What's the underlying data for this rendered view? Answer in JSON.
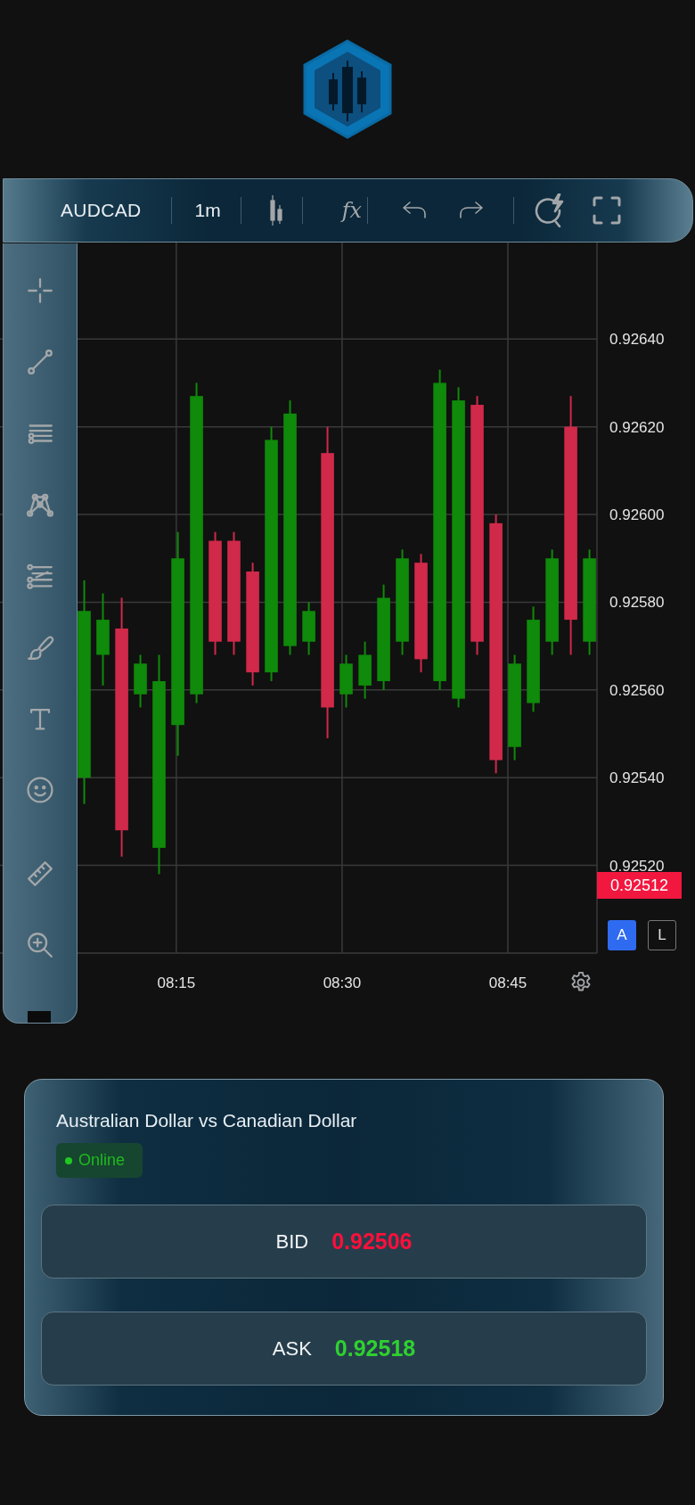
{
  "toolbar": {
    "symbol": "AUDCAD",
    "interval": "1m",
    "indicators": "fx"
  },
  "chart": {
    "chart_data": {
      "type": "candlestick",
      "grid": true,
      "xlim": [
        479.05,
        533.06
      ],
      "ylim": [
        0.925,
        0.92662
      ],
      "x": [
        486.67,
        488.36,
        490.06,
        491.75,
        493.44,
        495.14,
        496.83,
        498.52,
        500.21,
        501.91,
        503.6,
        505.29,
        506.99,
        508.68,
        510.37,
        512.07,
        513.76,
        515.45,
        517.14,
        518.84,
        520.53,
        522.22,
        523.92,
        525.61,
        527.3,
        529.0,
        530.69,
        532.38
      ],
      "ohlc": [
        [
          0.9254,
          0.92585,
          0.92534,
          0.92578
        ],
        [
          0.92568,
          0.92582,
          0.92561,
          0.92576
        ],
        [
          0.92574,
          0.92581,
          0.92522,
          0.92528
        ],
        [
          0.92559,
          0.92568,
          0.92556,
          0.92566
        ],
        [
          0.92524,
          0.92568,
          0.92518,
          0.92562
        ],
        [
          0.92552,
          0.92596,
          0.92545,
          0.9259
        ],
        [
          0.92559,
          0.9263,
          0.92557,
          0.92627
        ],
        [
          0.92594,
          0.92596,
          0.92568,
          0.92571
        ],
        [
          0.92594,
          0.92596,
          0.92568,
          0.92571
        ],
        [
          0.92587,
          0.92589,
          0.92561,
          0.92564
        ],
        [
          0.92564,
          0.9262,
          0.92562,
          0.92617
        ],
        [
          0.9257,
          0.92626,
          0.92568,
          0.92623
        ],
        [
          0.92571,
          0.9258,
          0.92568,
          0.92578
        ],
        [
          0.92614,
          0.9262,
          0.92549,
          0.92556
        ],
        [
          0.92559,
          0.92568,
          0.92556,
          0.92566
        ],
        [
          0.92561,
          0.92571,
          0.92558,
          0.92568
        ],
        [
          0.92562,
          0.92584,
          0.9256,
          0.92581
        ],
        [
          0.92571,
          0.92592,
          0.92568,
          0.9259
        ],
        [
          0.92589,
          0.92591,
          0.92564,
          0.92567
        ],
        [
          0.92562,
          0.92633,
          0.9256,
          0.9263
        ],
        [
          0.92558,
          0.92629,
          0.92556,
          0.92626
        ],
        [
          0.92625,
          0.92627,
          0.92568,
          0.92571
        ],
        [
          0.92598,
          0.926,
          0.92541,
          0.92544
        ],
        [
          0.92547,
          0.92568,
          0.92544,
          0.92566
        ],
        [
          0.92557,
          0.92579,
          0.92555,
          0.92576
        ],
        [
          0.92571,
          0.92592,
          0.92568,
          0.9259
        ],
        [
          0.9262,
          0.92627,
          0.92568,
          0.92576
        ],
        [
          0.92571,
          0.92592,
          0.92568,
          0.9259
        ]
      ],
      "yticks": [
        {
          "value": 0.9264,
          "label": "0.92640"
        },
        {
          "value": 0.9262,
          "label": "0.92620"
        },
        {
          "value": 0.926,
          "label": "0.92600"
        },
        {
          "value": 0.9258,
          "label": "0.92580"
        },
        {
          "value": 0.9256,
          "label": "0.92560"
        },
        {
          "value": 0.9254,
          "label": "0.92540"
        },
        {
          "value": 0.9252,
          "label": "0.92520"
        }
      ],
      "xticks": [
        {
          "value": 495,
          "label": "08:15"
        },
        {
          "value": 510,
          "label": "08:30"
        },
        {
          "value": 525,
          "label": "08:45"
        }
      ]
    },
    "last_price": "0.92512",
    "scale_buttons": [
      {
        "label": "A",
        "selected": true
      },
      {
        "label": "L",
        "selected": false
      }
    ]
  },
  "quote": {
    "title": "Australian Dollar vs Canadian Dollar",
    "status": {
      "label": "Online",
      "online": true
    },
    "prices": [
      {
        "label": "BID",
        "value": "0.92506",
        "kind": "bid"
      },
      {
        "label": "ASK",
        "value": "0.92518",
        "kind": "ask"
      }
    ]
  }
}
